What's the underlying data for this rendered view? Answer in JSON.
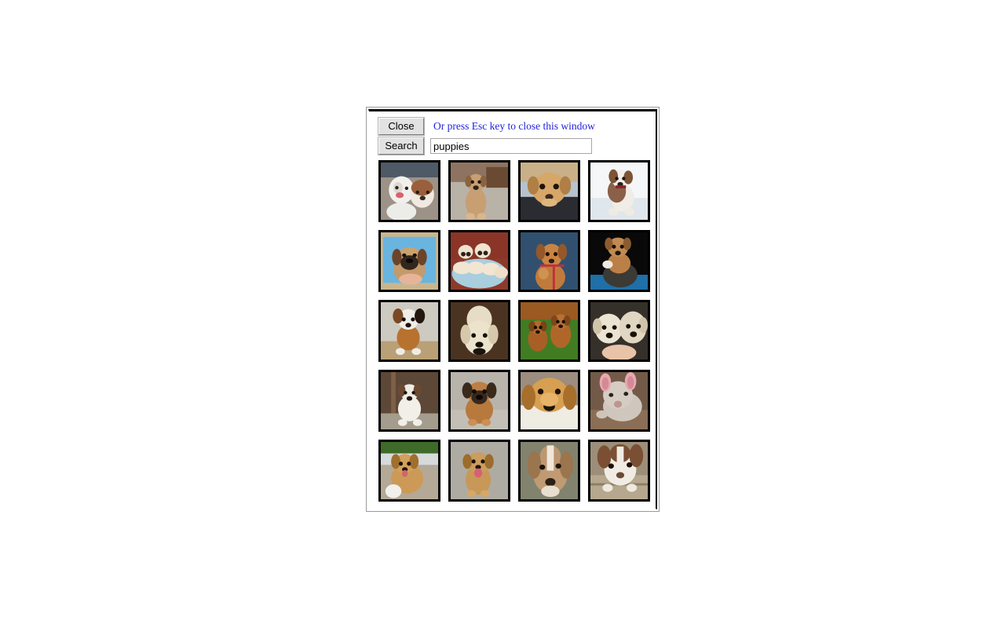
{
  "window": {
    "name": "image-search-popup"
  },
  "toolbar": {
    "close_label": "Close",
    "search_label": "Search",
    "esc_hint": "Or press Esc key to close this window",
    "hint_color": "#2222dd",
    "search_value": "puppies",
    "search_placeholder": ""
  },
  "grid": {
    "columns": 4,
    "rows": 5,
    "thumb_size": 79,
    "border_color": "#000000",
    "thumbnails": [
      {
        "id": 1,
        "alt": "two puppies lying together on pavement, white and brown",
        "row": 1,
        "col": 1
      },
      {
        "id": 2,
        "alt": "tan puppy sitting on tiled floor",
        "row": 1,
        "col": 2
      },
      {
        "id": 3,
        "alt": "golden puppy face resting on blue blanket",
        "row": 1,
        "col": 3
      },
      {
        "id": 4,
        "alt": "brown and white beagle puppy sitting, white background",
        "row": 1,
        "col": 4
      },
      {
        "id": 5,
        "alt": "pug mix puppy held in hands, blue sky, framed photo",
        "row": 2,
        "col": 1
      },
      {
        "id": 6,
        "alt": "litter of cream puppies on blue blanket on red couch",
        "row": 2,
        "col": 2
      },
      {
        "id": 7,
        "alt": "tan puppy with red leash held up, blue background",
        "row": 2,
        "col": 3
      },
      {
        "id": 8,
        "alt": "puppy sitting inside a boot, black background",
        "row": 2,
        "col": 4
      },
      {
        "id": 9,
        "alt": "brown and white boxer puppy standing on mat",
        "row": 3,
        "col": 1
      },
      {
        "id": 10,
        "alt": "cream labrador puppy face, dark brown background",
        "row": 3,
        "col": 2
      },
      {
        "id": 11,
        "alt": "two brown puppies walking in green grass",
        "row": 3,
        "col": 3
      },
      {
        "id": 12,
        "alt": "two cream labrador puppies cuddling",
        "row": 3,
        "col": 4
      },
      {
        "id": 13,
        "alt": "white bulldog puppy sitting by wooden door",
        "row": 4,
        "col": 1
      },
      {
        "id": 14,
        "alt": "tan puppy with dark muzzle sitting, grey background",
        "row": 4,
        "col": 2
      },
      {
        "id": 15,
        "alt": "golden retriever puppy lying with head on white blanket",
        "row": 4,
        "col": 3
      },
      {
        "id": 16,
        "alt": "grey pit bull puppy lying down, pink ears",
        "row": 4,
        "col": 4
      },
      {
        "id": 17,
        "alt": "yellow labrador puppy panting in sunlight on patio",
        "row": 5,
        "col": 1
      },
      {
        "id": 18,
        "alt": "tan puppy with pink tongue sitting on concrete",
        "row": 5,
        "col": 2
      },
      {
        "id": 19,
        "alt": "brown and white puppy face with white blaze",
        "row": 5,
        "col": 3
      },
      {
        "id": 20,
        "alt": "brown and white puppy lying on tile floor",
        "row": 5,
        "col": 4
      }
    ]
  }
}
